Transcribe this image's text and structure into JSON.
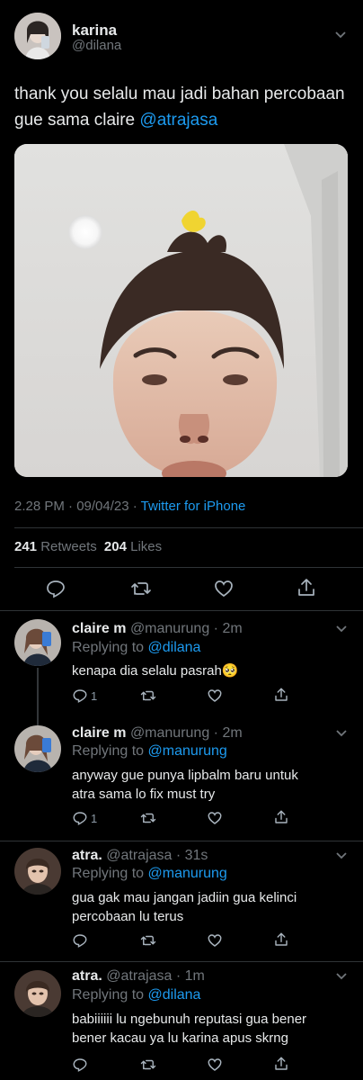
{
  "main_tweet": {
    "display_name": "karina",
    "handle": "@dilana",
    "text": "thank you selalu mau jadi bahan percobaan gue sama claire",
    "mention": "@atrajasa",
    "timestamp": "2.28 PM · 09/04/23 ·",
    "source": "Twitter for iPhone",
    "retweets_count": "241",
    "retweets_label": "Retweets",
    "likes_count": "204",
    "likes_label": "Likes"
  },
  "replies": [
    {
      "display_name": "claire m",
      "handle_time": "@manurung · 2m",
      "replying_label": "Replying to",
      "replying_to": "@dilana",
      "text": "kenapa dia selalu pasrah",
      "emoji": "🥺",
      "reply_count": "1"
    },
    {
      "display_name": "claire m",
      "handle_time": "@manurung · 2m",
      "replying_label": "Replying to",
      "replying_to": "@manurung",
      "text_line1": "anyway gue punya lipbalm baru untuk",
      "text_line2": "atra sama lo fix must try",
      "reply_count": "1"
    },
    {
      "display_name": "atra.",
      "handle_time": "@atrajasa · 31s",
      "replying_label": "Replying to",
      "replying_to": "@manurung",
      "text_line1": "gua gak mau jangan jadiin gua kelinci",
      "text_line2": "percobaan lu terus"
    },
    {
      "display_name": "atra.",
      "handle_time": "@atrajasa · 1m",
      "replying_label": "Replying to",
      "replying_to": "@dilana",
      "text_line1": "babiiiiii lu ngebunuh reputasi gua bener",
      "text_line2": "bener kacau ya lu karina apus skrng"
    }
  ],
  "colors": {
    "background": "#000000",
    "text": "#e7e9ea",
    "muted": "#71767b",
    "link": "#1d9bf0",
    "divider": "#2f3336"
  },
  "icons": [
    "reply-icon",
    "retweet-icon",
    "like-icon",
    "share-icon",
    "chevron-down-icon"
  ]
}
